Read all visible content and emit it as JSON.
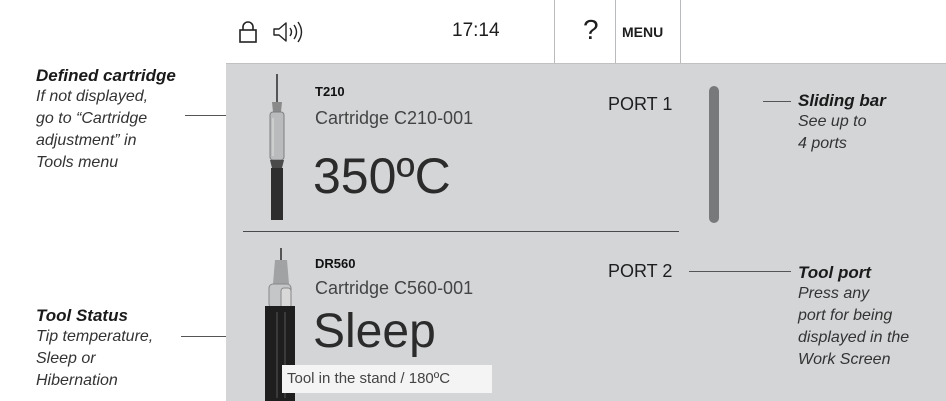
{
  "topbar": {
    "time": "17:14",
    "help_label": "?",
    "menu_label": "MENU",
    "lock_icon": "lock-icon",
    "sound_icon": "speaker-icon"
  },
  "ports": [
    {
      "model": "T210",
      "cartridge": "Cartridge  C210-001",
      "status": "350ºC",
      "port_label": "PORT 1"
    },
    {
      "model": "DR560",
      "cartridge": "Cartridge  C560-001",
      "status": "Sleep",
      "status_detail": "Tool in the stand  / 180ºC",
      "port_label": "PORT 2"
    }
  ],
  "annotations": {
    "defined_cartridge": {
      "title": "Defined cartridge",
      "lines": [
        "If not displayed,",
        "go to “Cartridge",
        "adjustment” in",
        "Tools menu"
      ]
    },
    "tool_status": {
      "title": "Tool Status",
      "lines": [
        "Tip temperature,",
        "Sleep or",
        "Hibernation"
      ]
    },
    "sliding_bar": {
      "title": "Sliding bar",
      "lines": [
        "See up to",
        "4 ports"
      ]
    },
    "tool_port": {
      "title": "Tool port",
      "lines": [
        "Press any",
        "port for being",
        "displayed in the",
        "Work Screen"
      ]
    }
  },
  "colors": {
    "screen_bg": "#d3d5d7",
    "topbar_bg": "#ffffff",
    "slider": "#77797b"
  }
}
